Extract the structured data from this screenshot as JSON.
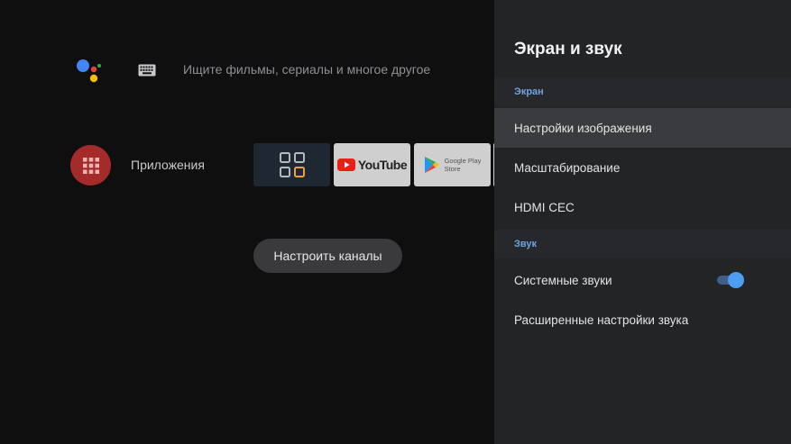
{
  "search": {
    "placeholder": "Ищите фильмы, сериалы и многое другое"
  },
  "apps": {
    "label": "Приложения"
  },
  "tiles": {
    "youtube_label": "YouTube",
    "play_line1": "Google Play",
    "play_line2": "Store"
  },
  "setup_channels": {
    "label": "Настроить каналы"
  },
  "settings_panel": {
    "title": "Экран и звук",
    "sections": {
      "screen": "Экран",
      "sound": "Звук"
    },
    "items": [
      {
        "label": "Настройки изображения",
        "focused": true
      },
      {
        "label": "Масштабирование"
      },
      {
        "label": "HDMI CEC"
      },
      {
        "label": "Системные звуки",
        "toggle": "on"
      },
      {
        "label": "Расширенные настройки звука"
      }
    ]
  },
  "colors": {
    "accent_blue": "#4d9df3",
    "section_header": "#6fa3e0",
    "apps_red": "#a52a2a",
    "panel_bg": "#232426",
    "home_bg": "#0f0f10"
  },
  "icons": {
    "assistant": "google-assistant-icon",
    "keyboard": "keyboard-icon",
    "apps": "apps-grid-icon",
    "channels": "channels-grid-icon",
    "youtube": "youtube-logo",
    "play": "google-play-logo"
  }
}
